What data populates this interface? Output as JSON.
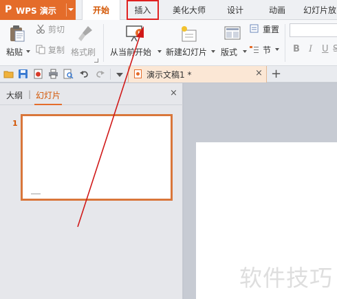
{
  "app": {
    "logo_glyph": "P",
    "name": "WPS 演示",
    "accent_color": "#e46c2a"
  },
  "menu_tabs": [
    {
      "label": "开始",
      "active": true
    },
    {
      "label": "插入",
      "highlighted": true
    },
    {
      "label": "美化大师"
    },
    {
      "label": "设计"
    },
    {
      "label": "动画"
    },
    {
      "label": "幻灯片放"
    }
  ],
  "ribbon": {
    "paste": "粘贴",
    "cut": "剪切",
    "copy": "复制",
    "format_painter": "格式刷",
    "from_current": "从当前开始",
    "new_slide": "新建幻灯片",
    "layout": "版式",
    "reset": "重置",
    "section": "节",
    "bold": "B",
    "italic": "I",
    "underline": "U",
    "strike": "S"
  },
  "document_tab": {
    "title": "演示文稿1 *",
    "close": "×"
  },
  "new_tab": "+",
  "panel": {
    "tab_outline": "大纲",
    "separator": "|",
    "tab_slides": "幻灯片",
    "close": "×",
    "slide_number": "1"
  },
  "watermark": "软件技巧"
}
